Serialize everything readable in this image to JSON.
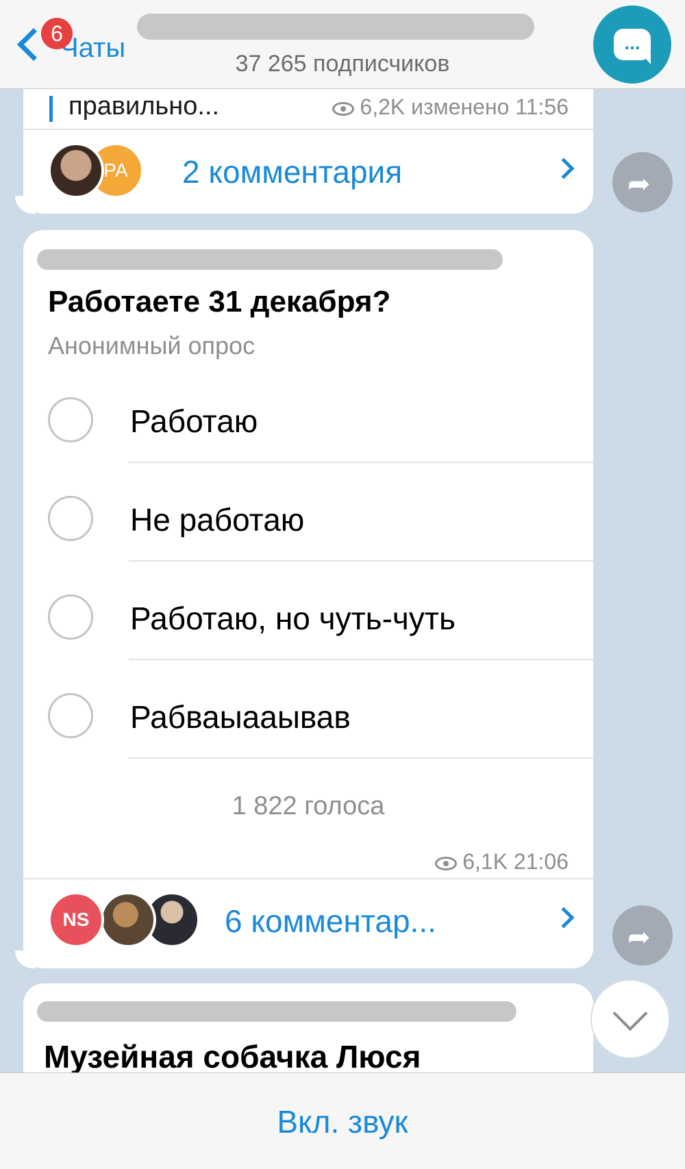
{
  "header": {
    "back_label": "Чаты",
    "unread_badge": "6",
    "subscribers": "37 265 подписчиков",
    "avatar_glyph": "..."
  },
  "prev_post": {
    "text": "правильно...",
    "views": "6,2K",
    "edited": "изменено 11:56",
    "comments_label": "2 комментария",
    "commenter_initials": "РА"
  },
  "poll_post": {
    "question": "Работаете 31 декабря?",
    "type": "Анонимный опрос",
    "options": [
      "Работаю",
      "Не работаю",
      "Работаю, но чуть-чуть",
      "Рабваыааывав"
    ],
    "votes": "1 822 голоса",
    "views": "6,1K",
    "time": "21:06",
    "comments_label": "6 комментар...",
    "commenter_initials": "NS"
  },
  "next_post": {
    "title": "Музейная собачка Люся"
  },
  "footer": {
    "unmute_label": "Вкл. звук"
  },
  "colors": {
    "accent": "#1a8ad8",
    "badge": "#e74040",
    "channel_avatar": "#1d9cba",
    "ns_avatar": "#e8505b",
    "ra_avatar": "#f4a838"
  },
  "icons": {
    "back": "chevron-left-icon",
    "views": "eye-icon",
    "share": "share-arrow-icon",
    "scroll": "chevron-down-icon"
  }
}
